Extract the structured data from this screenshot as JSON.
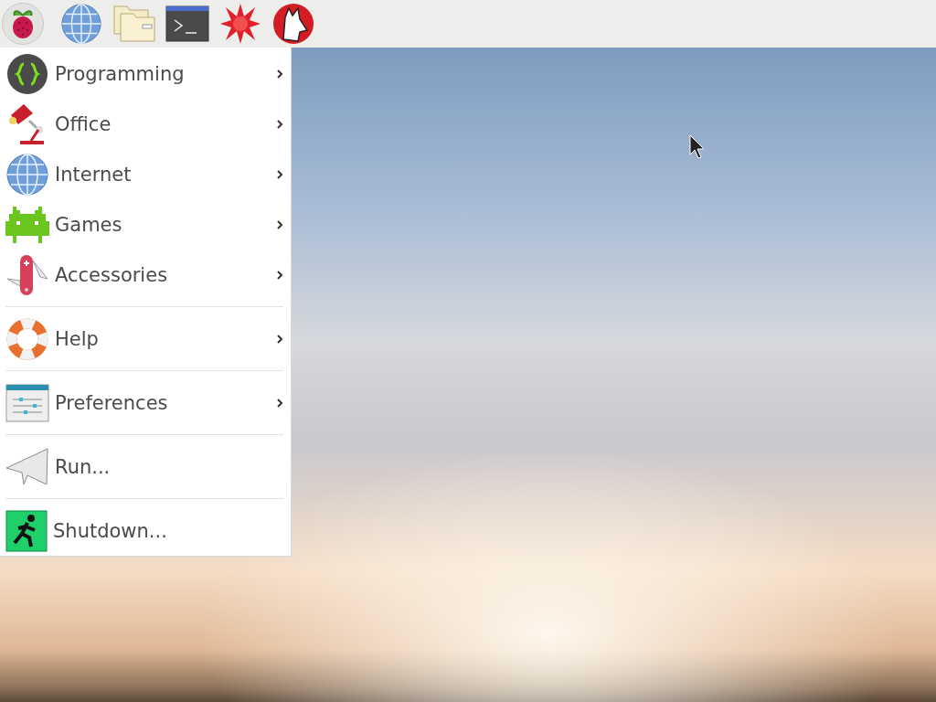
{
  "taskbar": {
    "launchers": [
      {
        "kind": "raspberry",
        "selected": true
      },
      {
        "kind": "globe",
        "selected": false
      },
      {
        "kind": "folder",
        "selected": false
      },
      {
        "kind": "terminal",
        "selected": false
      },
      {
        "kind": "star",
        "selected": false
      },
      {
        "kind": "wolf",
        "selected": false
      }
    ]
  },
  "menu": {
    "groups": [
      [
        {
          "label": "Programming",
          "submenu": true
        },
        {
          "label": "Office",
          "submenu": true
        },
        {
          "label": "Internet",
          "submenu": true
        },
        {
          "label": "Games",
          "submenu": true
        },
        {
          "label": "Accessories",
          "submenu": true
        }
      ],
      [
        {
          "label": "Help",
          "submenu": true
        }
      ],
      [
        {
          "label": "Preferences",
          "submenu": true
        }
      ],
      [
        {
          "label": "Run...",
          "submenu": false
        }
      ],
      [
        {
          "label": "Shutdown...",
          "submenu": false
        }
      ]
    ]
  }
}
